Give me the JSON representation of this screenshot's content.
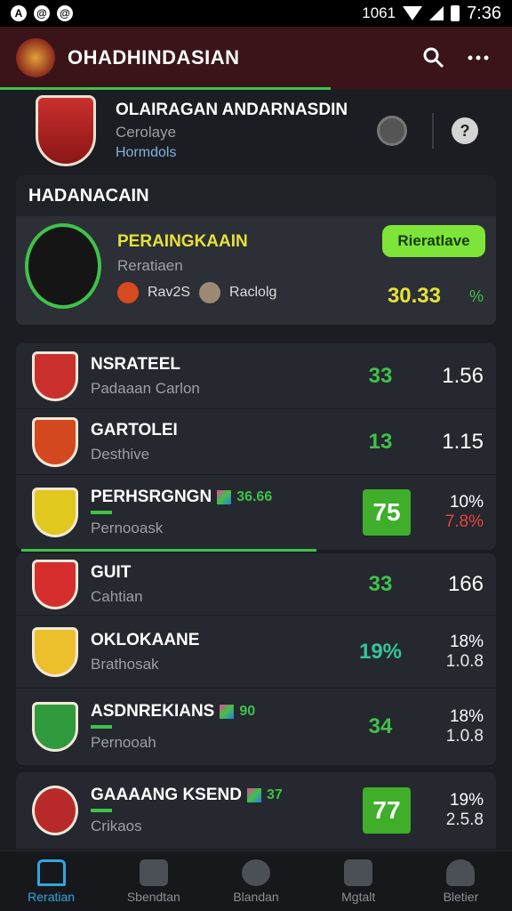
{
  "status_bar": {
    "time": "7:36",
    "indicator": "1061"
  },
  "header": {
    "title": "OHADHINDASIAN",
    "search_icon": "search-icon",
    "more_icon": "more-icon"
  },
  "league": {
    "name": "OLAIRAGAN ANDARNASDIN",
    "subtitle": "Cerolaye",
    "link": "Hormdols"
  },
  "featured": {
    "section_title": "HADANACAIN",
    "name": "PERAINGKAAIN",
    "subtitle": "Reratiaen",
    "tag1": "Rav2S",
    "tag2": "Raclolg",
    "button": "Rieratlave",
    "score": "30.33",
    "pct": "%"
  },
  "list1": [
    {
      "name": "NSRATEEL",
      "sub": "Padaaan Carlon",
      "val": "33",
      "right": "1.56",
      "crest_color": "#c9302c"
    },
    {
      "name": "GARTOLEI",
      "sub": "Desthive",
      "val": "13",
      "right": "1.15",
      "crest_color": "#d4481f"
    },
    {
      "name": "PERHSRGNGN",
      "sub": "Pernooask",
      "badge": "36.66",
      "box": "75",
      "r1": "10%",
      "r2": "7.8%",
      "crest_color": "#e0c81e"
    }
  ],
  "list2": [
    {
      "name": "GUIT",
      "sub": "Cahtian",
      "val": "33",
      "right": "166",
      "crest_color": "#d62d2d"
    },
    {
      "name": "OKLOKAANE",
      "sub": "Brathosak",
      "val": "19%",
      "r1": "18%",
      "r2": "1.0.8",
      "crest_color": "#ecc02d"
    },
    {
      "name": "ASDNREKIANS",
      "sub": "Pernooah",
      "badge": "90",
      "val": "34",
      "r1": "18%",
      "r2": "1.0.8",
      "crest_color": "#2f9a3b"
    }
  ],
  "list3": [
    {
      "name": "GAAAANG KSEND",
      "sub": "Crikaos",
      "badge": "37",
      "box": "77",
      "r1": "19%",
      "r2": "2.5.8",
      "crest_color": "#b82a2a"
    }
  ],
  "nav": [
    {
      "label": "Reratian",
      "icon": "home-icon",
      "active": true
    },
    {
      "label": "Sbendtan",
      "icon": "stats-icon",
      "active": false
    },
    {
      "label": "Blandan",
      "icon": "ball-icon",
      "active": false
    },
    {
      "label": "Mgtalt",
      "icon": "mail-icon",
      "active": false
    },
    {
      "label": "Bletier",
      "icon": "profile-icon",
      "active": false
    }
  ]
}
